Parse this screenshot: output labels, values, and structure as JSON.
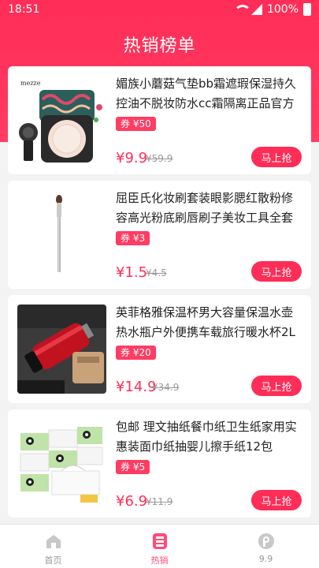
{
  "status_bar": {
    "time": "18:51",
    "battery": "100%"
  },
  "header": {
    "title": "热销榜单"
  },
  "products": [
    {
      "name": "媚族小蘑菇气垫bb霜遮瑕保湿持久控油不脱妆防水cc霜隔离正品官方",
      "coupon": "券 ¥50",
      "price": "¥9.9",
      "original_price": "¥59.9",
      "buy_label": "马上抢",
      "image_text": "mezze"
    },
    {
      "name": "屈臣氏化妆刷套装眼影腮红散粉修容高光粉底刷唇刷子美妆工具全套",
      "coupon": "券 ¥3",
      "price": "¥1.5",
      "original_price": "¥4.5",
      "buy_label": "马上抢"
    },
    {
      "name": "英菲格雅保温杯男大容量保温水壶热水瓶户外便携车载旅行暖水杯2L",
      "coupon": "券 ¥20",
      "price": "¥14.9",
      "original_price": "¥34.9",
      "buy_label": "马上抢"
    },
    {
      "name": "包邮 理文抽纸餐巾纸卫生纸家用实惠装面巾纸抽婴儿擦手纸12包",
      "coupon": "券 ¥5",
      "price": "¥6.9",
      "original_price": "¥11.9",
      "buy_label": "马上抢"
    }
  ],
  "tabbar": [
    {
      "label": "首页",
      "icon": "home-icon",
      "active": false
    },
    {
      "label": "热销",
      "icon": "hot-sale-icon",
      "active": true
    },
    {
      "label": "9.9",
      "icon": "price-tag-icon",
      "active": false
    }
  ],
  "colors": {
    "accent": "#ff2d57",
    "tab_active": "#ff4b7a"
  }
}
